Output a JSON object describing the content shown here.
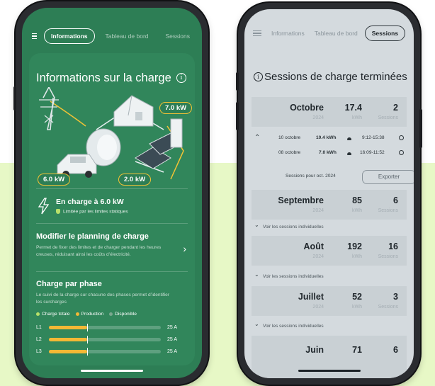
{
  "left_phone": {
    "tabs": [
      {
        "label": "Informations",
        "active": true
      },
      {
        "label": "Tableau de bord",
        "active": false
      },
      {
        "label": "Sessions",
        "active": false
      }
    ],
    "title": "Informations sur la charge",
    "power_labels": {
      "top_right": "7.0 kW",
      "bottom_left": "6.0 kW",
      "bottom_right": "2.0 kW"
    },
    "charging": {
      "title": "En charge à 6.0 kW",
      "note": "Limitée par les limites statiques"
    },
    "planning": {
      "title": "Modifier le planning de charge",
      "description": "Permet de fixer des limites et de charger pendant les heures creuses, réduisant ainsi les coûts d’électricité."
    },
    "phase": {
      "title": "Charge par phase",
      "description": "Le suivi de la charge sur chacune des phases permet d’identifier les surcharges",
      "legend": [
        {
          "label": "Charge totale",
          "color": "#b8e06a"
        },
        {
          "label": "Production",
          "color": "#f3b835"
        },
        {
          "label": "Disponible",
          "color": "#7aa88f"
        }
      ],
      "phases": [
        {
          "label": "L1",
          "value": "25 A",
          "fill": 0.34
        },
        {
          "label": "L2",
          "value": "25 A",
          "fill": 0.34
        },
        {
          "label": "L3",
          "value": "25 A",
          "fill": 0.34
        }
      ]
    }
  },
  "right_phone": {
    "tabs": [
      {
        "label": "Informations",
        "active": false
      },
      {
        "label": "Tableau de bord",
        "active": false
      },
      {
        "label": "Sessions",
        "active": true
      }
    ],
    "title": "Sessions de charge terminées",
    "months": [
      {
        "name": "Octobre",
        "year": "2024",
        "kwh": "17.4",
        "kwh_unit": "kWh",
        "sessions": "2",
        "sessions_unit": "Sessions"
      },
      {
        "name": "Septembre",
        "year": "2024",
        "kwh": "85",
        "kwh_unit": "kWh",
        "sessions": "6",
        "sessions_unit": "Sessions"
      },
      {
        "name": "Août",
        "year": "2024",
        "kwh": "192",
        "kwh_unit": "kWh",
        "sessions": "16",
        "sessions_unit": "Sessions"
      },
      {
        "name": "Juillet",
        "year": "2024",
        "kwh": "52",
        "kwh_unit": "kWh",
        "sessions": "3",
        "sessions_unit": "Sessions"
      },
      {
        "name": "Juin",
        "kwh": "71",
        "sessions": "6"
      }
    ],
    "sessions": [
      {
        "date": "10 octobre",
        "energy": "10.4 kWh",
        "time": "9:12-15:38"
      },
      {
        "date": "08 octobre",
        "energy": "7.0 kWh",
        "time": "16:09-11:52"
      }
    ],
    "sessions_for": "Sessions pour oct. 2024",
    "export_label": "Exporter",
    "see_individual": "Voir les sessions individuelles"
  }
}
